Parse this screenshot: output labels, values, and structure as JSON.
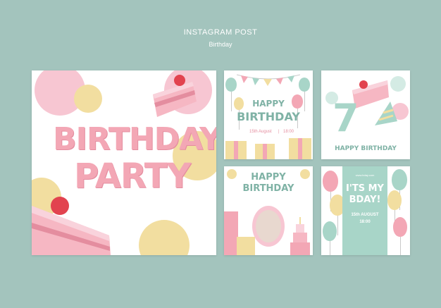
{
  "header": {
    "title": "INSTAGRAM POST",
    "subtitle": "Birthday"
  },
  "card1": {
    "line1": "BIRTHDAY",
    "line2": "PARTY"
  },
  "card2": {
    "line1": "HAPPY",
    "line2": "BIRTHDAY",
    "date": "15th August",
    "sep": "|",
    "time": "18:00"
  },
  "card3": {
    "number": "7",
    "text": "HAPPY BIRTHDAY"
  },
  "card4": {
    "line1": "HAPPY",
    "line2": "BIRTHDAY"
  },
  "card5": {
    "site": "www.bday.com",
    "line1": "I'TS MY",
    "line2": "BDAY!",
    "date": "15th AUGUST",
    "time": "18:00"
  },
  "colors": {
    "background": "#a3c4bd",
    "pink": "#f3a7b5",
    "mint": "#7fb2a5",
    "yellow": "#f2dea0"
  }
}
